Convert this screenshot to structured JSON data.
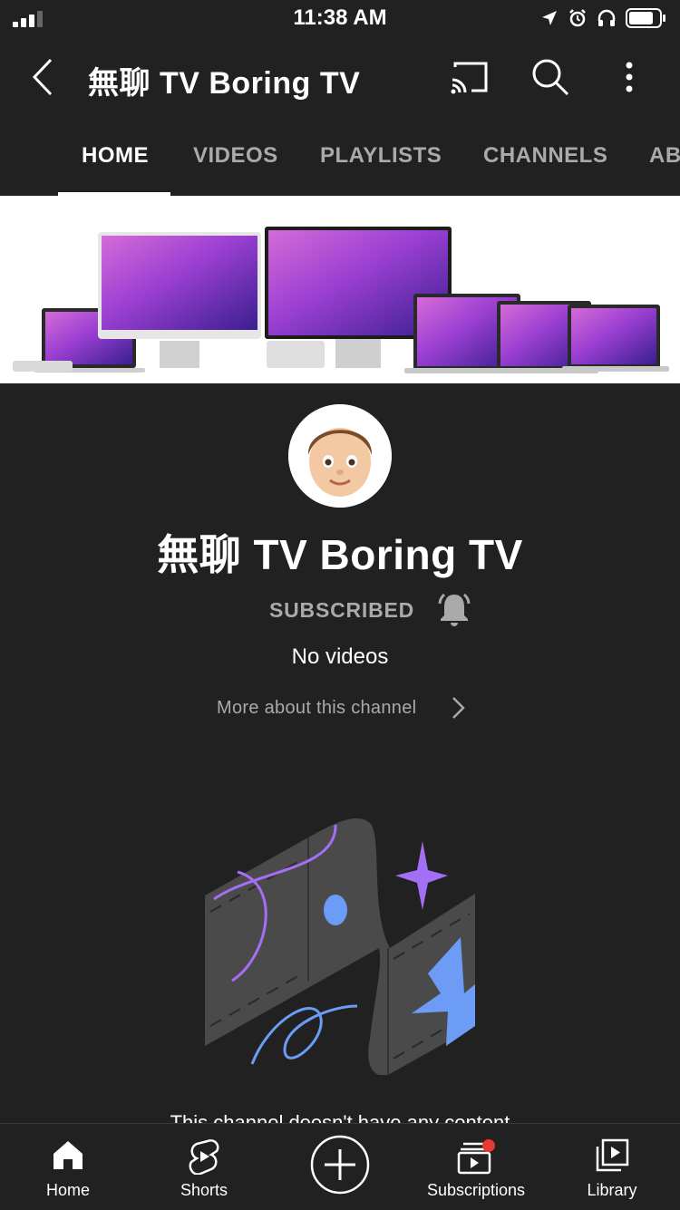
{
  "status": {
    "time": "11:38 AM"
  },
  "header": {
    "title": "無聊 TV Boring TV"
  },
  "tabs": [
    {
      "label": "HOME"
    },
    {
      "label": "VIDEOS"
    },
    {
      "label": "PLAYLISTS"
    },
    {
      "label": "CHANNELS"
    },
    {
      "label": "AB"
    }
  ],
  "active_tab": "HOME",
  "channel": {
    "name": "無聊 TV Boring TV",
    "subscribe_label": "SUBSCRIBED",
    "video_count_text": "No videos",
    "more_about_label": "More about this channel"
  },
  "empty_state": {
    "message": "This channel doesn't have any content"
  },
  "bottom_nav": [
    {
      "label": "Home",
      "icon": "home-icon"
    },
    {
      "label": "Shorts",
      "icon": "shorts-icon"
    },
    {
      "label": "",
      "icon": "create-plus-icon"
    },
    {
      "label": "Subscriptions",
      "icon": "subscriptions-icon"
    },
    {
      "label": "Library",
      "icon": "library-icon"
    }
  ],
  "colors": {
    "background": "#212121",
    "accent_purple": "#a46ef5",
    "accent_blue": "#6c9cf5",
    "notification_dot": "#e53935"
  }
}
